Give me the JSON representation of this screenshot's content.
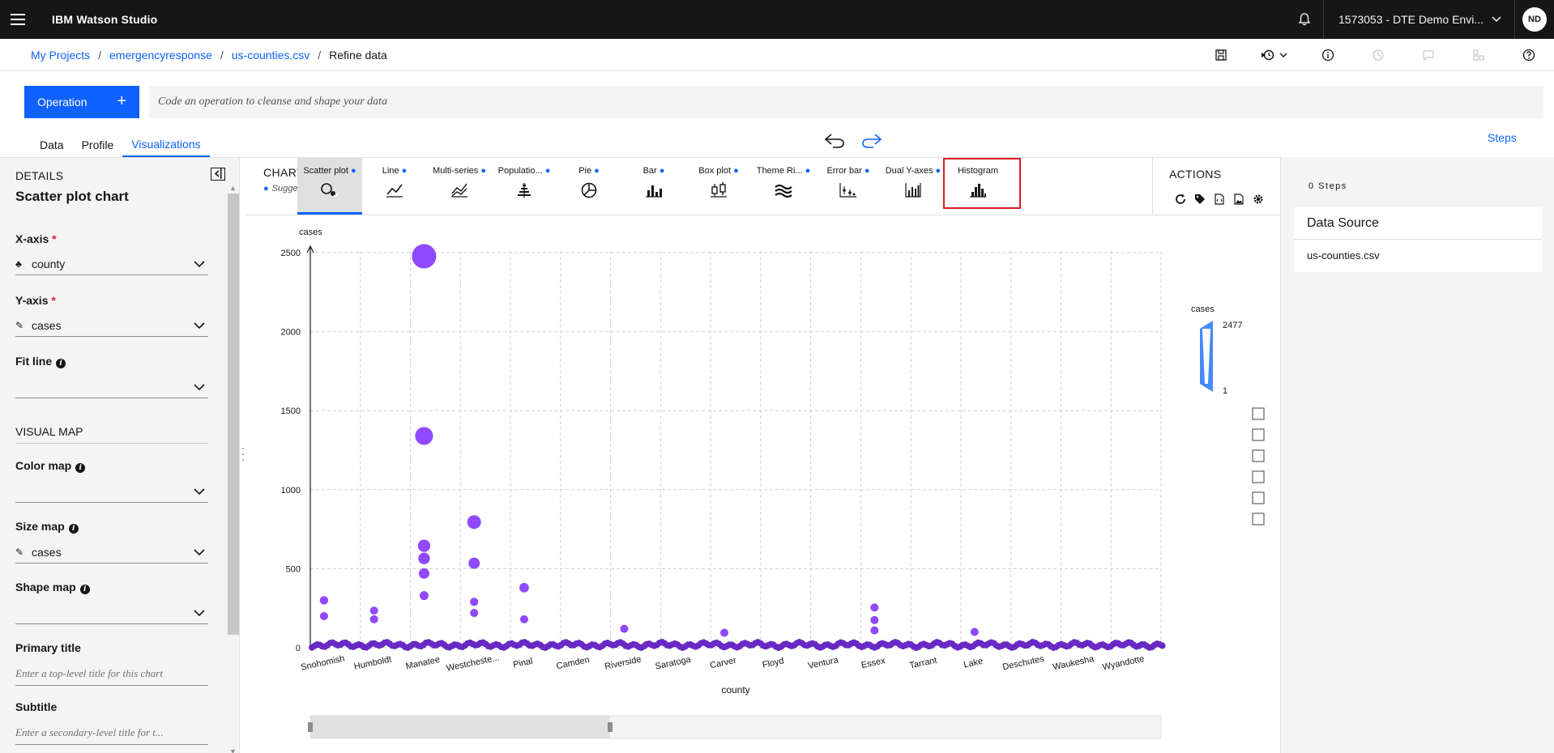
{
  "app": {
    "name": "IBM Watson Studio"
  },
  "account": {
    "label": "1573053 - DTE Demo Envi...",
    "initials": "ND"
  },
  "breadcrumb": [
    "My Projects",
    "emergencyresponse",
    "us-counties.csv",
    "Refine data"
  ],
  "operation": {
    "button_label": "Operation",
    "plus": "+",
    "placeholder": "Code an operation to cleanse and shape your data"
  },
  "tabs": [
    "Data",
    "Profile",
    "Visualizations"
  ],
  "active_tab": "Visualizations",
  "steps_link": "Steps",
  "details": {
    "section": "DETAILS",
    "title": "Scatter plot chart",
    "x_axis": {
      "label": "X-axis",
      "value": "county"
    },
    "y_axis": {
      "label": "Y-axis",
      "value": "cases"
    },
    "fit_line": {
      "label": "Fit line",
      "value": ""
    },
    "visual_map": "VISUAL MAP",
    "color_map": {
      "label": "Color map",
      "value": ""
    },
    "size_map": {
      "label": "Size map",
      "value": "cases"
    },
    "shape_map": {
      "label": "Shape map",
      "value": ""
    },
    "primary_title": {
      "label": "Primary title",
      "placeholder": "Enter a top-level title for this chart"
    },
    "subtitle": {
      "label": "Subtitle",
      "placeholder": "Enter a secondary-level title for t..."
    }
  },
  "chart_type": {
    "label": "CHART TYPE",
    "suggested": "Suggested charts",
    "types": [
      "Scatter plot",
      "Line",
      "Multi-series",
      "Populatio...",
      "Pie",
      "Bar",
      "Box plot",
      "Theme Ri...",
      "Error bar",
      "Dual Y-axes",
      "Histogram"
    ],
    "suggested_flags": [
      true,
      true,
      true,
      true,
      true,
      true,
      true,
      true,
      true,
      true,
      false
    ],
    "selected": "Scatter plot",
    "highlighted": "Dual Y-axes"
  },
  "actions": {
    "label": "ACTIONS"
  },
  "chart_data": {
    "type": "scatter",
    "xlabel": "county",
    "ylabel": "cases",
    "ylim": [
      0,
      2500
    ],
    "yticks": [
      0,
      500,
      1000,
      1500,
      2000,
      2500
    ],
    "grid": true,
    "x_tick_labels": [
      "Snohomish",
      "Humboldt",
      "Manatee",
      "Westcheste...",
      "Pinal",
      "Camden",
      "Riverside",
      "Saratoga",
      "Carver",
      "Floyd",
      "Ventura",
      "Essex",
      "Tarrant",
      "Lake",
      "Deschutes",
      "Waukesha",
      "Wyandotte"
    ],
    "points": [
      {
        "county_index": 2,
        "y": 2477
      },
      {
        "county_index": 2,
        "y": 1340
      },
      {
        "county_index": 3,
        "y": 795
      },
      {
        "county_index": 2,
        "y": 645
      },
      {
        "county_index": 3,
        "y": 535
      },
      {
        "county_index": 2,
        "y": 565
      },
      {
        "county_index": 2,
        "y": 470
      },
      {
        "county_index": 4,
        "y": 380
      },
      {
        "county_index": 0,
        "y": 300
      },
      {
        "county_index": 3,
        "y": 290
      },
      {
        "county_index": 11,
        "y": 255
      },
      {
        "county_index": 1,
        "y": 235
      },
      {
        "county_index": 0,
        "y": 200
      },
      {
        "county_index": 2,
        "y": 330
      },
      {
        "county_index": 3,
        "y": 220
      },
      {
        "county_index": 1,
        "y": 180
      },
      {
        "county_index": 4,
        "y": 180
      },
      {
        "county_index": 11,
        "y": 175
      },
      {
        "county_index": 6,
        "y": 120
      },
      {
        "county_index": 11,
        "y": 110
      },
      {
        "county_index": 13,
        "y": 100
      },
      {
        "county_index": 8,
        "y": 95
      }
    ],
    "visual_map": {
      "label": "cases",
      "max": 2477,
      "min": 1,
      "max_label": "2477",
      "min_label": "1"
    },
    "colors": {
      "point": "#6929c4",
      "point_fill": "#8a3ffc",
      "visual_map": "#4589ff"
    }
  },
  "steps_panel": {
    "count_label": "0 Steps",
    "card_title": "Data Source",
    "card_file": "us-counties.csv"
  }
}
